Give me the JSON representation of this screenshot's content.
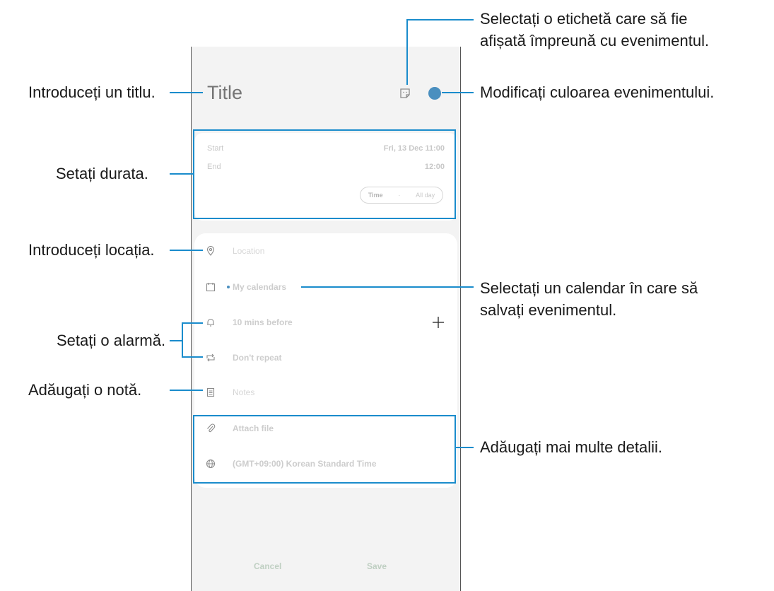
{
  "phone": {
    "title_placeholder": "Title",
    "time": {
      "start_label": "Start",
      "start_value": "Fri, 13 Dec  11:00",
      "end_label": "End",
      "end_value": "12:00",
      "toggle_time": "Time",
      "toggle_all_day": "All day"
    },
    "details": {
      "location": "Location",
      "calendar": "My calendars",
      "alarm": "10 mins before",
      "repeat": "Don't repeat",
      "notes": "Notes",
      "attach": "Attach file",
      "timezone": "(GMT+09:00) Korean Standard Time"
    },
    "bottom": {
      "cancel": "Cancel",
      "save": "Save"
    }
  },
  "annotations": {
    "title": "Introduceți un titlu.",
    "duration": "Setați durata.",
    "location": "Introduceți locația.",
    "alarm": "Setați o alarmă.",
    "note": "Adăugați o notă.",
    "sticker_line1": "Selectați o etichetă care să fie",
    "sticker_line2": "afișată împreună cu evenimentul.",
    "color": "Modificați culoarea evenimentului.",
    "calendar_line1": "Selectați un calendar în care să",
    "calendar_line2": "salvați evenimentul.",
    "more": "Adăugați mai multe detalii."
  },
  "colors": {
    "accent": "#4a8fbf",
    "highlight": "#1a8ccc"
  },
  "icons": [
    "sticker-icon",
    "location-pin-icon",
    "calendar-icon",
    "bell-icon",
    "repeat-icon",
    "notes-icon",
    "paperclip-icon",
    "globe-icon",
    "plus-icon"
  ]
}
